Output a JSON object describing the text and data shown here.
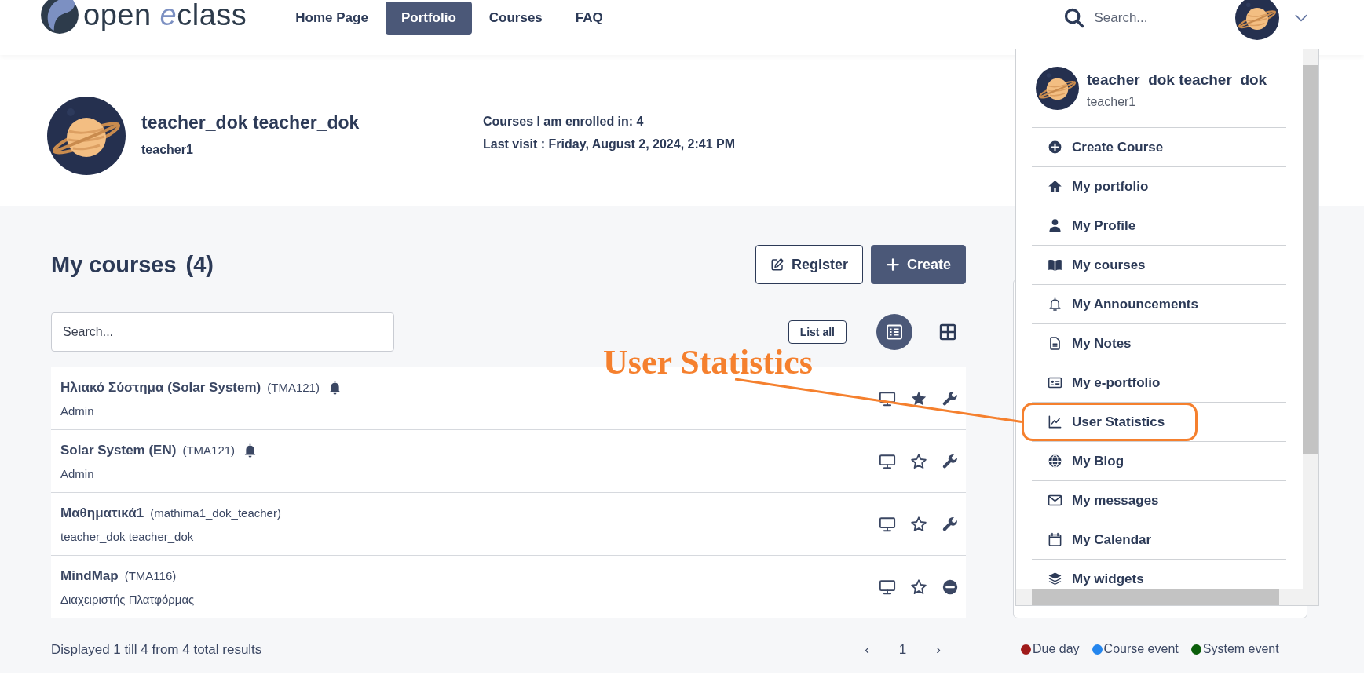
{
  "header": {
    "logo": {
      "prefix": "open ",
      "mark": "e",
      "suffix": "class"
    },
    "nav": [
      {
        "label": "Home Page",
        "selected": false
      },
      {
        "label": "Portfolio",
        "selected": true
      },
      {
        "label": "Courses",
        "selected": false
      },
      {
        "label": "FAQ",
        "selected": false
      }
    ],
    "search": {
      "placeholder": "Search..."
    }
  },
  "profile": {
    "name": "teacher_dok teacher_dok",
    "username": "teacher1",
    "enrolled": "Courses I am enrolled in: 4",
    "last_visit": "Last visit : Friday, August 2, 2024, 2:41 PM"
  },
  "courses_panel": {
    "title": "My courses",
    "count": "(4)",
    "buttons": [
      {
        "label": "Register",
        "kind": "outline"
      },
      {
        "label": "Create",
        "kind": "primary"
      }
    ],
    "search": {
      "placeholder": "Search..."
    },
    "list_all": "List all",
    "views": [
      {
        "kind": "list",
        "selected": true
      },
      {
        "kind": "grid",
        "selected": false
      }
    ],
    "courses": [
      {
        "title": "Ηλιακό Σύστημα (Solar System)",
        "code": "(TMA121)",
        "owner": "Admin",
        "bell": true,
        "starred": true,
        "kind": "wrench"
      },
      {
        "title": "Solar System (EN)",
        "code": "(TMA121)",
        "owner": "Admin",
        "bell": true,
        "starred": false,
        "kind": "wrench"
      },
      {
        "title": "Μαθηματικά1",
        "code": "(mathima1_dok_teacher)",
        "owner": "teacher_dok teacher_dok",
        "bell": false,
        "starred": false,
        "kind": "wrench"
      },
      {
        "title": "MindMap",
        "code": "(TMA116)",
        "owner": "Διαχειριστής Πλατφόρμας",
        "bell": false,
        "starred": false,
        "kind": "unregister"
      }
    ],
    "summary": "Displayed 1 till 4 from 4 total results",
    "pagination": [
      "‹",
      "1",
      "›"
    ]
  },
  "calendar_legend": [
    {
      "label": "Due day",
      "color": "#a01b1b"
    },
    {
      "label": "Course event",
      "color": "#2486ee"
    },
    {
      "label": "System event",
      "color": "#0b5e0b"
    }
  ],
  "user_menu": {
    "name": "teacher_dok teacher_dok",
    "username": "teacher1",
    "items": [
      {
        "label": "Create Course",
        "kind": "plus-circle",
        "highlighted": false
      },
      {
        "label": "My portfolio",
        "kind": "home",
        "highlighted": false
      },
      {
        "label": "My Profile",
        "kind": "user",
        "highlighted": false
      },
      {
        "label": "My courses",
        "kind": "book",
        "highlighted": false
      },
      {
        "label": "My Announcements",
        "kind": "bell-outline",
        "highlighted": false
      },
      {
        "label": "My Notes",
        "kind": "file",
        "highlighted": false
      },
      {
        "label": "My e-portfolio",
        "kind": "id-card",
        "highlighted": false
      },
      {
        "label": "User Statistics",
        "kind": "chart",
        "highlighted": true
      },
      {
        "label": "My Blog",
        "kind": "globe",
        "highlighted": false
      },
      {
        "label": "My messages",
        "kind": "envelope",
        "highlighted": false
      },
      {
        "label": "My Calendar",
        "kind": "calendar",
        "highlighted": false
      },
      {
        "label": "My widgets",
        "kind": "layers",
        "highlighted": false
      }
    ]
  },
  "annotation": {
    "text": "User Statistics"
  }
}
